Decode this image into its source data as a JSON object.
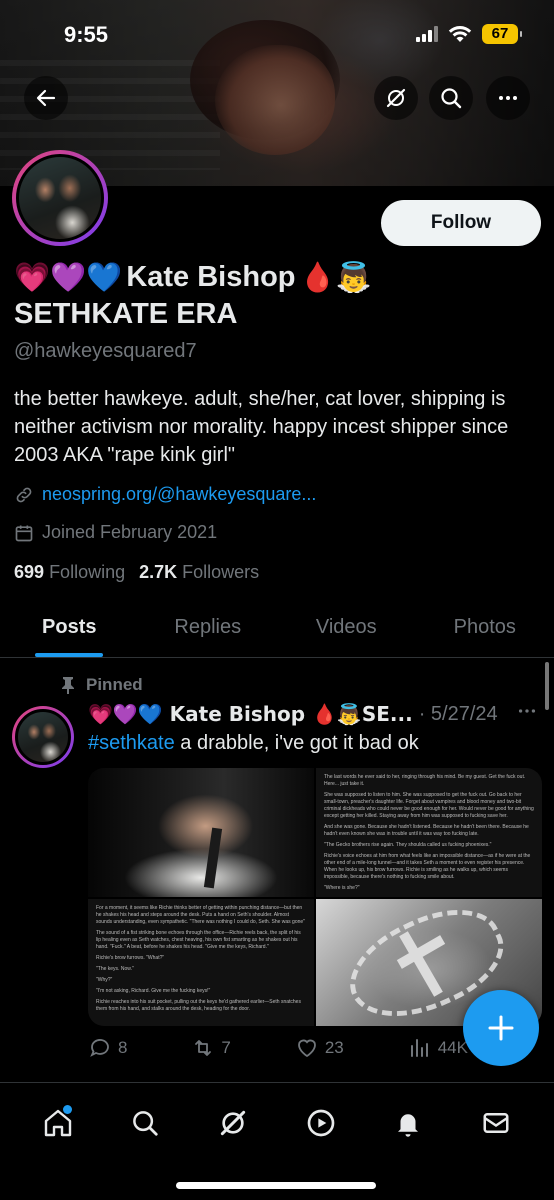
{
  "status": {
    "time": "9:55",
    "battery": "67"
  },
  "profile": {
    "name_emoji_prefix": "💗💜💙",
    "name": "Kate Bishop",
    "name_emoji_suffix": "🩸👼",
    "name_line2": "SETHKATE ERA",
    "handle": "@hawkeyesquared7",
    "bio": "the better hawkeye. adult, she/her, cat lover, shipping is neither activism nor morality. happy incest shipper since 2003 AKA \"rape kink girl\"",
    "link": "neospring.org/@hawkeyesquare...",
    "joined": "Joined February 2021",
    "following_count": "699",
    "following_label": "Following",
    "followers_count": "2.7K",
    "followers_label": "Followers",
    "follow_label": "Follow"
  },
  "tabs": [
    "Posts",
    "Replies",
    "Videos",
    "Photos"
  ],
  "post": {
    "pinned_label": "Pinned",
    "author": "💗💜💙 Kate Bishop 🩸👼SE...",
    "date": "· 5/27/24",
    "hashtag": "#sethkate",
    "text": " a drabble, i've got it bad ok",
    "media_text_top": [
      "The last words he ever said to her, ringing through his mind. Be my guest. Get the fuck out. Here... just take it.",
      "She was supposed to listen to him. She was supposed to get the fuck out. Go back to her small-town, preacher's daughter life. Forget about vampires and blood money and two-bit criminal dickheads who could never be good enough for her. Would never be good for anything except getting her killed. Staying away from him was supposed to fucking save her.",
      "And she was gone. Because she hadn't listened. Because he hadn't been there. Because he hadn't even known she was in trouble until it was way too fucking late.",
      "\"The Gecko brothers rise again. They shoulda called us fucking phoenixes.\"",
      "Richie's voice echoes at him from what feels like an impossible distance—as if he were at the other end of a mile-long tunnel—and it takes Seth a moment to even register his presence. When he looks up, his brow furrows. Richie is smiling as he walks up, which seems impossible, because there's nothing to fucking smile about.",
      "\"Where is she?\""
    ],
    "media_text_bottom": [
      "For a moment, it seems like Richie thinks better of getting within punching distance—but then he shakes his head and steps around the desk. Puts a hand on Seth's shoulder. Almost sounds understanding, even sympathetic. \"There was nothing I could do, Seth. She was gone\"",
      "The sound of a fist striking bone echoes through the office—Richie reels back, the split of his lip healing even as Seth watches, chest heaving, his own fist smarting as he shakes out his hand. \"Fuck.\" A beat, before he shakes his head. \"Give me the keys, Richard.\"",
      "Richie's brow furrows. \"What?\"",
      "\"The keys. Now.\"",
      "\"Why?\"",
      "\"I'm not asking, Richard. Give me the fucking keys!\"",
      "Richie reaches into his suit pocket, pulling out the keys he'd gathered earlier—Seth snatches them from his hand, and stalks around the desk, heading for the door."
    ],
    "replies": "8",
    "reposts": "7",
    "likes": "23",
    "views": "44K"
  }
}
